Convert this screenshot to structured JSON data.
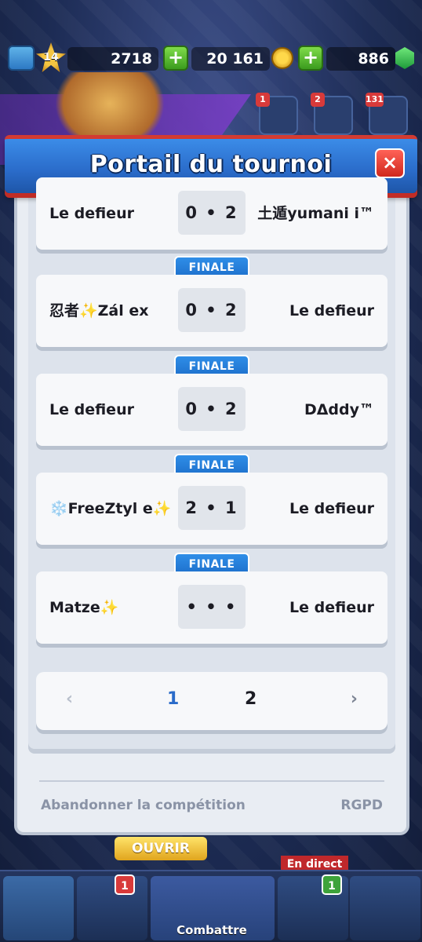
{
  "resources": {
    "level": "14",
    "trophies": "2718",
    "gold": "20 161",
    "gems": "886"
  },
  "header_badges": {
    "social": "1",
    "clan": "2",
    "menu": "131"
  },
  "modal": {
    "title": "Portail du tournoi",
    "close_label": "×",
    "round_label": "FINALE",
    "matches": [
      {
        "left": "Le defieur",
        "score": "0 • 2",
        "right": "土遁yumani i™"
      },
      {
        "left": "忍者✨Zál ex",
        "score": "0 • 2",
        "right": "Le defieur"
      },
      {
        "left": "Le defieur",
        "score": "0 • 2",
        "right": "DΔddy™"
      },
      {
        "left": "❄️FreeZtyl e✨",
        "score": "2 • 1",
        "right": "Le defieur"
      },
      {
        "left": "Matze✨",
        "score": "• • •",
        "right": "Le defieur"
      }
    ],
    "pager": {
      "prev": "‹",
      "page1": "1",
      "page2": "2",
      "next": "›"
    },
    "footer": {
      "abandon": "Abandonner la compétition",
      "rgpd": "RGPD"
    }
  },
  "bottom_nav": {
    "ouvrir": "OUVRIR",
    "combattre": "Combattre",
    "en_direct": "En direct",
    "cards_badge": "1",
    "live_badge": "1"
  },
  "colors": {
    "title_blue": "#2a6bc9",
    "title_red": "#d33b32",
    "finale_blue": "#1d6fcb",
    "close_red": "#d0281d"
  }
}
